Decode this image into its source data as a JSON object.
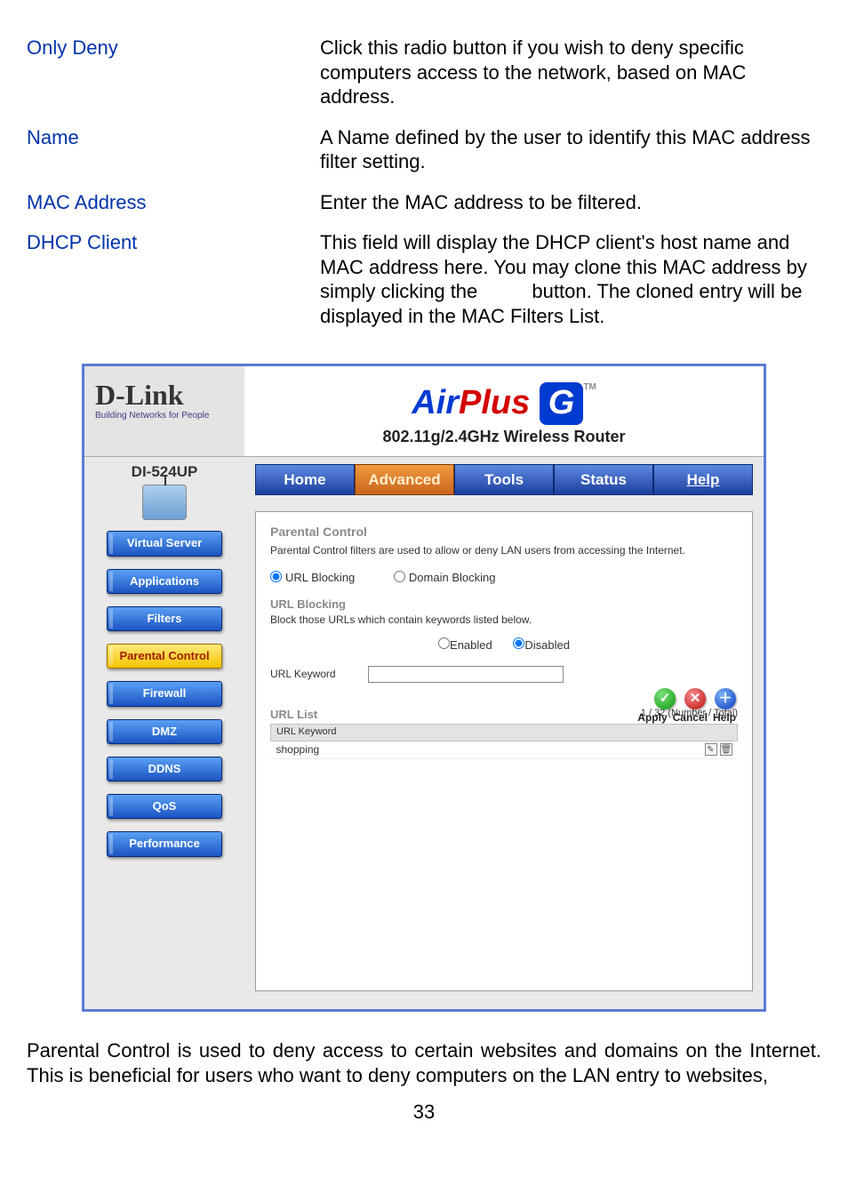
{
  "definitions": [
    {
      "term": "Only Deny",
      "desc": "Click this radio button if you wish to deny specific computers access to the network, based on MAC address."
    },
    {
      "term": "Name",
      "desc": "A Name defined by the user to identify this MAC address filter setting."
    },
    {
      "term": "MAC Address",
      "desc": "Enter the MAC address to be filtered."
    },
    {
      "term": "DHCP Client",
      "desc": "This field will display the DHCP client's host name and MAC address here. You may clone this MAC address by simply clicking the          button. The cloned entry will be displayed in the MAC Filters List."
    }
  ],
  "router": {
    "brand": "D-Link",
    "brand_sub": "Building Networks for People",
    "product_line_prefix": "Air",
    "product_line_mid": "Plus",
    "product_line_suffix": "G",
    "product_tm": "TM",
    "product_sub": "802.11g/2.4GHz Wireless Router",
    "model": "DI-524UP",
    "sidebar": [
      {
        "label": "Virtual Server",
        "highlight": false
      },
      {
        "label": "Applications",
        "highlight": false
      },
      {
        "label": "Filters",
        "highlight": false
      },
      {
        "label": "Parental Control",
        "highlight": true
      },
      {
        "label": "Firewall",
        "highlight": false
      },
      {
        "label": "DMZ",
        "highlight": false
      },
      {
        "label": "DDNS",
        "highlight": false
      },
      {
        "label": "QoS",
        "highlight": false
      },
      {
        "label": "Performance",
        "highlight": false
      }
    ],
    "tabs": {
      "home": "Home",
      "advanced": "Advanced",
      "tools": "Tools",
      "status": "Status",
      "help": "Help"
    },
    "parental": {
      "title": "Parental Control",
      "subtitle": "Parental Control filters are used to allow or deny LAN users from accessing the Internet.",
      "mode_url": "URL Blocking",
      "mode_domain": "Domain Blocking",
      "blocking_title": "URL Blocking",
      "blocking_sub": "Block those URLs which contain keywords listed below.",
      "enabled": "Enabled",
      "disabled": "Disabled",
      "kw_label": "URL Keyword",
      "kw_value": "",
      "actions": {
        "apply": "Apply",
        "cancel": "Cancel",
        "help": "Help"
      },
      "url_list_title": "URL List",
      "url_list_count": "1 / 32 (Number / Total)",
      "url_list_header": "URL Keyword",
      "url_rows": [
        {
          "keyword": "shopping"
        }
      ]
    }
  },
  "closing": "Parental Control is used to deny access to certain websites and domains on the Internet. This is beneficial for users who want to deny computers on the LAN entry to websites,",
  "page_number": "33"
}
